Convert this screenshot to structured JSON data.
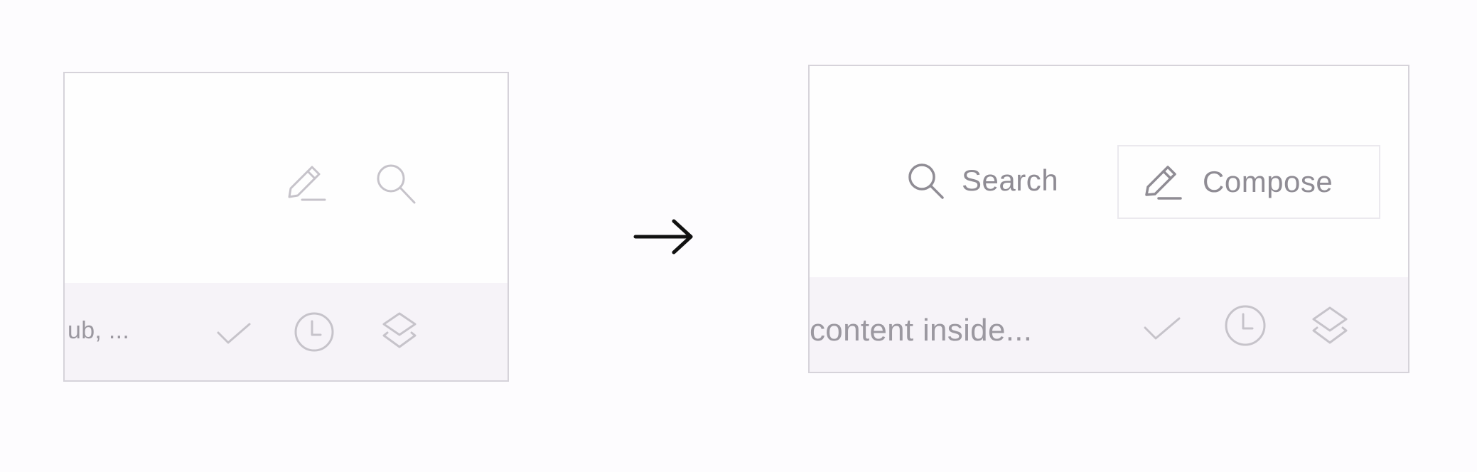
{
  "before_panel": {
    "toolbar": {
      "compose_icon": "pencil-icon",
      "search_icon": "search-icon"
    },
    "row": {
      "preview_text": "ub, ...",
      "icons": [
        "check-icon",
        "clock-icon",
        "layers-icon"
      ]
    }
  },
  "transition": {
    "arrow_icon": "right-arrow-icon"
  },
  "after_panel": {
    "toolbar": {
      "search_label": "Search",
      "search_icon": "search-icon",
      "compose_label": "Compose",
      "compose_icon": "pencil-icon"
    },
    "row": {
      "preview_text": "content inside...",
      "icons": [
        "check-icon",
        "clock-icon",
        "layers-icon"
      ]
    }
  },
  "colors": {
    "icon_stroke": "#c3c0c7",
    "label_text": "#8f8c94",
    "row_background": "#f6f3f8",
    "panel_border": "#d6d3da"
  }
}
